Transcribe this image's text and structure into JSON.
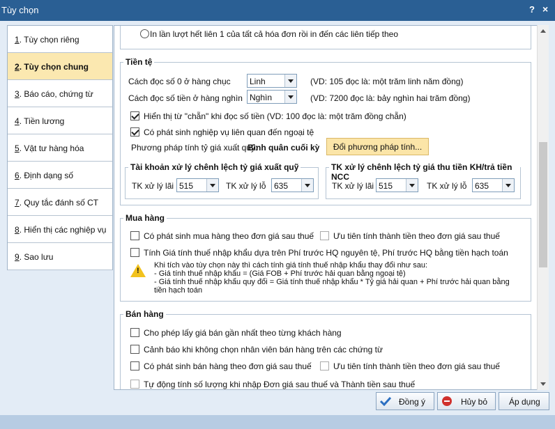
{
  "window": {
    "title": "Tùy chọn",
    "help": "?",
    "close": "×"
  },
  "sidebar": [
    {
      "num": "1",
      "label": ". Tùy chọn riêng"
    },
    {
      "num": "2",
      "label": ". Tùy chọn chung"
    },
    {
      "num": "3",
      "label": ". Báo cáo, chứng từ"
    },
    {
      "num": "4",
      "label": ". Tiền lương"
    },
    {
      "num": "5",
      "label": ". Vật tư hàng hóa"
    },
    {
      "num": "6",
      "label": ". Định dạng số"
    },
    {
      "num": "7",
      "label": ". Quy tắc đánh số CT"
    },
    {
      "num": "8",
      "label": ". Hiển thị các nghiệp vụ"
    },
    {
      "num": "9",
      "label": ". Sao lưu"
    }
  ],
  "print": {
    "radio_label": "In lần lượt hết liên 1 của tất cả hóa đơn rồi in đến các liên tiếp theo"
  },
  "currency": {
    "group_label": "Tiền tệ",
    "zero_label": "Cách đọc số 0 ở hàng chục",
    "zero_value": "Linh",
    "zero_hint": "(VD: 105 đọc là: một trăm linh năm đồng)",
    "thousand_label": "Cách đọc số tiền ở hàng nghìn",
    "thousand_value": "Nghìn",
    "thousand_hint": "(VD: 7200 đọc là: bảy nghìn hai trăm đồng)",
    "chan_label": "Hiển thị từ \"chẵn\" khi đọc số tiền (VD: 100 đọc là: một trăm đồng chẵn)",
    "foreign_label": "Có phát sinh nghiệp vụ liên quan đến ngoại tệ",
    "method_label": "Phương pháp tính tỷ giá xuất quỹ:",
    "method_value": "Bình quân cuối kỳ",
    "change_method": "Đổi phương pháp tính...",
    "left_group": "Tài khoản xử lý chênh lệch tỷ giá xuất quỹ",
    "left_gain_label": "TK xử lý lãi",
    "left_gain": "515",
    "left_loss_label": "TK xử lý lỗ",
    "left_loss": "635",
    "right_group": "TK xử lý chênh lệch tỷ giá thu tiền KH/trả tiền NCC",
    "right_gain_label": "TK xử lý lãi",
    "right_gain": "515",
    "right_loss_label": "TK xử lý lỗ",
    "right_loss": "635"
  },
  "purchase": {
    "group_label": "Mua hàng",
    "after_tax": "Có phát sinh mua hàng theo đơn giá sau thuế",
    "prefer_amount": "Ưu tiên tính thành tiền theo đơn giá sau thuế",
    "import_tax": "Tính Giá tính thuế nhập khẩu dựa trên Phí trước HQ nguyên tệ, Phí trước HQ bằng tiền hạch toán",
    "warn_icon": "!",
    "note1": "Khi tích vào tùy chọn này thì cách tính giá tính thuế nhập khẩu thay đổi như sau:",
    "note2": "- Giá tính thuế nhập khẩu = (Giá FOB + Phí trước hải quan bằng ngoại tệ)",
    "note3": "- Giá tính thuế nhập khẩu quy đổi = Giá tính thuế nhập khẩu * Tỷ giá hải quan + Phí trước hải quan bằng",
    "note4": "tiền hạch toán"
  },
  "sales": {
    "group_label": "Bán hàng",
    "latest_price": "Cho phép lấy giá bán gần nhất theo từng khách hàng",
    "warn_staff": "Cảnh báo khi không chọn nhân viên bán hàng trên các chứng từ",
    "after_tax": "Có phát sinh bán hàng theo đơn giá sau thuế",
    "prefer_amount": "Ưu tiên tính thành tiền theo đơn giá sau thuế",
    "auto_qty": "Tự động tính số lượng khi nhập Đơn giá sau thuế và Thành tiền sau thuế"
  },
  "buttons": {
    "ok": "Đồng ý",
    "cancel": "Hủy bỏ",
    "apply": "Áp dụng"
  },
  "colors": {
    "title_bar": "#2a5f94",
    "active_item": "#fbe8b0",
    "ok_icon": "#2b6fc1",
    "cancel_icon": "#d0312d"
  }
}
